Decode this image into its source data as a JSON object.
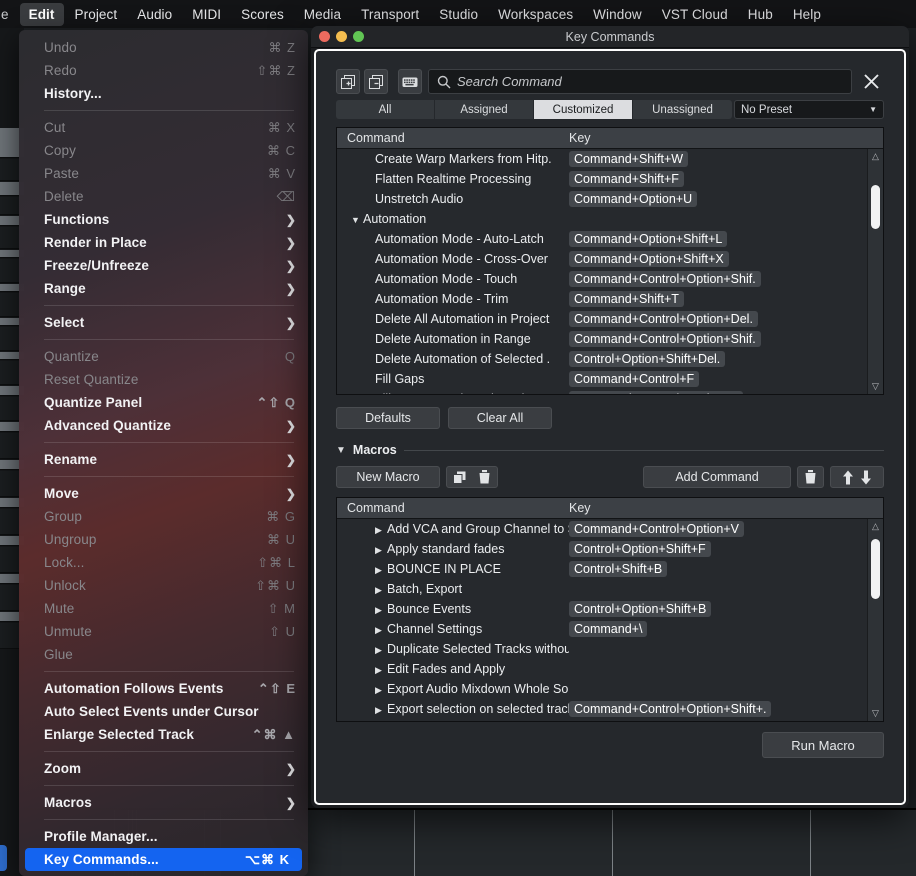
{
  "menubar": {
    "clipped_first": "e",
    "items": [
      {
        "label": "Edit",
        "active": true
      },
      {
        "label": "Project",
        "active": false
      },
      {
        "label": "Audio",
        "active": false
      },
      {
        "label": "MIDI",
        "active": false
      },
      {
        "label": "Scores",
        "active": false
      },
      {
        "label": "Media",
        "active": false
      },
      {
        "label": "Transport",
        "active": false
      },
      {
        "label": "Studio",
        "active": false
      },
      {
        "label": "Workspaces",
        "active": false
      },
      {
        "label": "Window",
        "active": false
      },
      {
        "label": "VST Cloud",
        "active": false
      },
      {
        "label": "Hub",
        "active": false
      },
      {
        "label": "Help",
        "active": false
      }
    ]
  },
  "edit_menu": {
    "items": [
      {
        "label": "Undo",
        "shortcut": "⌘ Z",
        "state": "disabled"
      },
      {
        "label": "Redo",
        "shortcut": "⇧⌘ Z",
        "state": "disabled"
      },
      {
        "label": "History...",
        "shortcut": "",
        "state": "enabled"
      },
      {
        "type": "separator"
      },
      {
        "label": "Cut",
        "shortcut": "⌘ X",
        "state": "disabled"
      },
      {
        "label": "Copy",
        "shortcut": "⌘ C",
        "state": "disabled"
      },
      {
        "label": "Paste",
        "shortcut": "⌘ V",
        "state": "disabled"
      },
      {
        "label": "Delete",
        "shortcut": "⌫",
        "state": "disabled"
      },
      {
        "label": "Functions",
        "shortcut": "",
        "state": "enabled",
        "submenu": true
      },
      {
        "label": "Render in Place",
        "shortcut": "",
        "state": "enabled",
        "submenu": true
      },
      {
        "label": "Freeze/Unfreeze",
        "shortcut": "",
        "state": "enabled",
        "submenu": true
      },
      {
        "label": "Range",
        "shortcut": "",
        "state": "enabled",
        "submenu": true
      },
      {
        "type": "separator"
      },
      {
        "label": "Select",
        "shortcut": "",
        "state": "enabled",
        "submenu": true
      },
      {
        "type": "separator"
      },
      {
        "label": "Quantize",
        "shortcut": "Q",
        "state": "disabled"
      },
      {
        "label": "Reset Quantize",
        "shortcut": "",
        "state": "disabled"
      },
      {
        "label": "Quantize Panel",
        "shortcut": "⌃⇧ Q",
        "state": "enabled"
      },
      {
        "label": "Advanced Quantize",
        "shortcut": "",
        "state": "enabled",
        "submenu": true
      },
      {
        "type": "separator"
      },
      {
        "label": "Rename",
        "shortcut": "",
        "state": "enabled",
        "submenu": true
      },
      {
        "type": "separator"
      },
      {
        "label": "Move",
        "shortcut": "",
        "state": "enabled",
        "submenu": true
      },
      {
        "label": "Group",
        "shortcut": "⌘ G",
        "state": "disabled"
      },
      {
        "label": "Ungroup",
        "shortcut": "⌘ U",
        "state": "disabled"
      },
      {
        "label": "Lock...",
        "shortcut": "⇧⌘ L",
        "state": "disabled"
      },
      {
        "label": "Unlock",
        "shortcut": "⇧⌘ U",
        "state": "disabled"
      },
      {
        "label": "Mute",
        "shortcut": "⇧ M",
        "state": "disabled"
      },
      {
        "label": "Unmute",
        "shortcut": "⇧ U",
        "state": "disabled"
      },
      {
        "label": "Glue",
        "shortcut": "",
        "state": "disabled"
      },
      {
        "type": "separator"
      },
      {
        "label": "Automation Follows Events",
        "shortcut": "⌃⇧ E",
        "state": "enabled"
      },
      {
        "label": "Auto Select Events under Cursor",
        "shortcut": "",
        "state": "enabled"
      },
      {
        "label": "Enlarge Selected Track",
        "shortcut": "⌃⌘ ▲",
        "state": "enabled"
      },
      {
        "type": "separator"
      },
      {
        "label": "Zoom",
        "shortcut": "",
        "state": "enabled",
        "submenu": true
      },
      {
        "type": "separator"
      },
      {
        "label": "Macros",
        "shortcut": "",
        "state": "enabled",
        "submenu": true
      },
      {
        "type": "separator"
      },
      {
        "label": "Profile Manager...",
        "shortcut": "",
        "state": "enabled"
      },
      {
        "label": "Key Commands...",
        "shortcut": "⌥⌘ K",
        "state": "selected"
      },
      {
        "type": "separator"
      }
    ]
  },
  "window": {
    "title": "Key Commands",
    "search": {
      "placeholder": "Search Command",
      "value": ""
    },
    "filters": [
      {
        "label": "All",
        "active": false
      },
      {
        "label": "Assigned",
        "active": false
      },
      {
        "label": "Customized",
        "active": true
      },
      {
        "label": "Unassigned",
        "active": false
      }
    ],
    "preset": {
      "value": "No Preset"
    },
    "commands_table": {
      "headers": {
        "command": "Command",
        "key": "Key"
      },
      "rows": [
        {
          "command": "Create Warp Markers from Hitp.",
          "key": "Command+Shift+W",
          "group": false
        },
        {
          "command": "Flatten Realtime Processing",
          "key": "Command+Shift+F",
          "group": false
        },
        {
          "command": "Unstretch Audio",
          "key": "Command+Option+U",
          "group": false
        },
        {
          "command": "Automation",
          "key": "",
          "group": true
        },
        {
          "command": "Automation Mode - Auto-Latch",
          "key": "Command+Option+Shift+L",
          "group": false
        },
        {
          "command": "Automation Mode - Cross-Over",
          "key": "Command+Option+Shift+X",
          "group": false
        },
        {
          "command": "Automation Mode - Touch",
          "key": "Command+Control+Option+Shif.",
          "group": false
        },
        {
          "command": "Automation Mode - Trim",
          "key": "Command+Shift+T",
          "group": false
        },
        {
          "command": "Delete All Automation in Project",
          "key": "Command+Control+Option+Del.",
          "group": false
        },
        {
          "command": "Delete Automation in Range",
          "key": "Command+Control+Option+Shif.",
          "group": false
        },
        {
          "command": "Delete Automation of Selected .",
          "key": "Control+Option+Shift+Del.",
          "group": false
        },
        {
          "command": "Fill Gaps",
          "key": "Command+Control+F",
          "group": false
        },
        {
          "command": "Fill Gaps on Selected Tracks",
          "key": "Command+Control+Option+F",
          "group": false
        }
      ]
    },
    "defaults_button": "Defaults",
    "clear_all_button": "Clear All",
    "macros_section": {
      "title": "Macros",
      "new_macro_button": "New Macro",
      "add_command_button": "Add Command",
      "run_macro_button": "Run Macro",
      "headers": {
        "command": "Command",
        "key": "Key"
      },
      "rows": [
        {
          "command": "Add VCA and Group Channel to Se.",
          "key": "Command+Control+Option+V"
        },
        {
          "command": "Apply standard fades",
          "key": "Control+Option+Shift+F"
        },
        {
          "command": "BOUNCE IN PLACE",
          "key": "Control+Shift+B"
        },
        {
          "command": "Batch, Export",
          "key": ""
        },
        {
          "command": "Bounce Events",
          "key": "Control+Option+Shift+B"
        },
        {
          "command": "Channel Settings",
          "key": "Command+\\"
        },
        {
          "command": "Duplicate Selected Tracks without.",
          "key": ""
        },
        {
          "command": "Edit Fades and Apply",
          "key": ""
        },
        {
          "command": "Export Audio Mixdown Whole Song",
          "key": ""
        },
        {
          "command": "Export selection on selected track.",
          "key": "Command+Control+Option+Shift+."
        }
      ]
    }
  },
  "colors": {
    "accent_blue": "#1464f0",
    "window_bg": "#25282c",
    "active_tab": "#dcdde0"
  }
}
